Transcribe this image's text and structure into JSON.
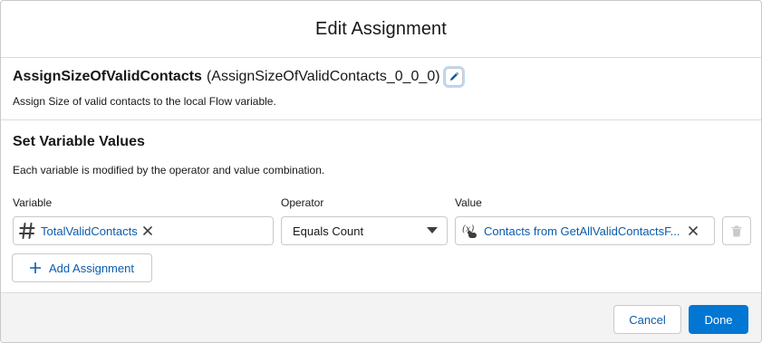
{
  "modal": {
    "title": "Edit Assignment"
  },
  "element": {
    "name": "AssignSizeOfValidContacts",
    "api_name": "(AssignSizeOfValidContacts_0_0_0)",
    "description": "Assign Size of valid contacts to the local Flow variable.",
    "edit_icon": "pencil-icon"
  },
  "set_variables": {
    "title": "Set Variable Values",
    "help": "Each variable is modified by the operator and value combination.",
    "labels": {
      "variable": "Variable",
      "operator": "Operator",
      "value": "Value"
    },
    "rows": [
      {
        "variable": {
          "icon": "number-icon",
          "label": "TotalValidContacts"
        },
        "operator": "Equals Count",
        "value": {
          "icon": "variable-icon",
          "label": "Contacts from GetAllValidContactsF..."
        }
      }
    ],
    "add_button": "Add Assignment"
  },
  "footer": {
    "cancel": "Cancel",
    "done": "Done"
  },
  "colors": {
    "brand": "#0176d3",
    "link": "#0b5cab",
    "footer_bg": "#f3f3f3"
  }
}
